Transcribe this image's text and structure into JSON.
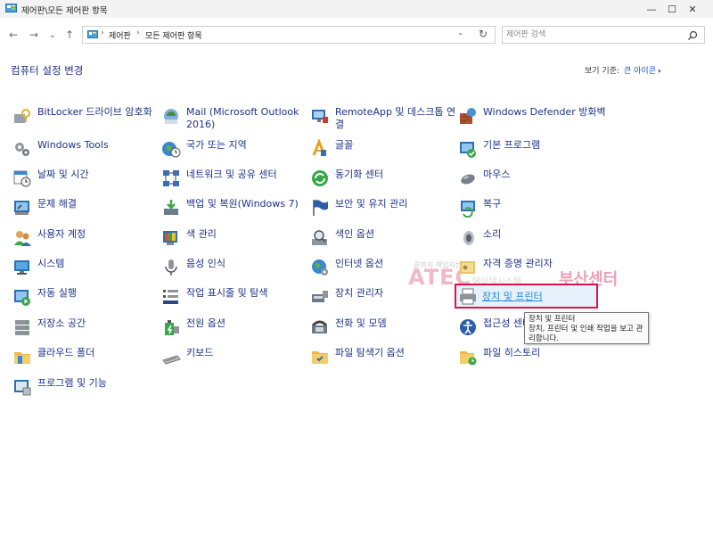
{
  "window": {
    "title": "제어판\\모든 제어판 항목",
    "minimize": "—",
    "maximize": "☐",
    "close": "✕"
  },
  "nav": {
    "back": "←",
    "forward": "→",
    "recent": "⌄",
    "up": "↑"
  },
  "address": {
    "crumbs": [
      "제어판",
      "모든 제어판 항목"
    ],
    "sep": "›",
    "dropdown": "⌄",
    "refresh": "↻"
  },
  "search": {
    "placeholder": "제어판 검색"
  },
  "heading": "컴퓨터 설정 변경",
  "view": {
    "label": "보기 기준:",
    "value": "큰 아이콘",
    "arrow": "▾"
  },
  "items": [
    {
      "label": "BitLocker 드라이브 암호화",
      "icon": "bitlocker-icon"
    },
    {
      "label": "Mail (Microsoft Outlook 2016)",
      "icon": "mail-icon"
    },
    {
      "label": "RemoteApp 및 데스크톱 연결",
      "icon": "remoteapp-icon"
    },
    {
      "label": "Windows Defender 방화벽",
      "icon": "firewall-icon"
    },
    {
      "label": "Windows Tools",
      "icon": "gears-icon"
    },
    {
      "label": "국가 또는 지역",
      "icon": "globe-clock-icon"
    },
    {
      "label": "글꼴",
      "icon": "font-icon"
    },
    {
      "label": "기본 프로그램",
      "icon": "default-programs-icon"
    },
    {
      "label": "날짜 및 시간",
      "icon": "calendar-clock-icon"
    },
    {
      "label": "네트워크 및 공유 센터",
      "icon": "network-icon"
    },
    {
      "label": "동기화 센터",
      "icon": "sync-icon"
    },
    {
      "label": "마우스",
      "icon": "mouse-icon"
    },
    {
      "label": "문제 해결",
      "icon": "troubleshoot-icon"
    },
    {
      "label": "백업 및 복원(Windows 7)",
      "icon": "backup-icon"
    },
    {
      "label": "보안 및 유지 관리",
      "icon": "flag-icon"
    },
    {
      "label": "복구",
      "icon": "recovery-icon"
    },
    {
      "label": "사용자 계정",
      "icon": "users-icon"
    },
    {
      "label": "색 관리",
      "icon": "color-management-icon"
    },
    {
      "label": "색인 옵션",
      "icon": "indexing-icon"
    },
    {
      "label": "소리",
      "icon": "speaker-icon"
    },
    {
      "label": "시스템",
      "icon": "system-icon"
    },
    {
      "label": "음성 인식",
      "icon": "microphone-icon"
    },
    {
      "label": "인터넷 옵션",
      "icon": "internet-options-icon"
    },
    {
      "label": "자격 증명 관리자",
      "icon": "credential-icon"
    },
    {
      "label": "자동 실행",
      "icon": "autoplay-icon"
    },
    {
      "label": "작업 표시줄 및 탐색",
      "icon": "taskbar-icon"
    },
    {
      "label": "장치 관리자",
      "icon": "device-manager-icon"
    },
    {
      "label": "장치 및 프린터",
      "icon": "printer-icon"
    },
    {
      "label": "저장소 공간",
      "icon": "storage-icon"
    },
    {
      "label": "전원 옵션",
      "icon": "power-icon"
    },
    {
      "label": "전화 및 모뎀",
      "icon": "phone-icon"
    },
    {
      "label": "접근성 센터",
      "icon": "accessibility-icon"
    },
    {
      "label": "클라우드 폴더",
      "icon": "cloud-folder-icon"
    },
    {
      "label": "키보드",
      "icon": "keyboard-icon"
    },
    {
      "label": "파일 탐색기 옵션",
      "icon": "folder-options-icon"
    },
    {
      "label": "파일 히스토리",
      "icon": "file-history-icon"
    },
    {
      "label": "프로그램 및 기능",
      "icon": "programs-icon"
    }
  ],
  "tooltip": {
    "title": "장치 및 프린터",
    "body": "장치, 프린터 및 인쇄 작업을 보고 관리합니다."
  },
  "watermark": {
    "small": "끝까지 책임지는",
    "brand": "ATEC",
    "mid": "에이텍시스템",
    "center": "부산센터"
  },
  "colors": {
    "link": "#1e3287",
    "highlight_border": "#e01248",
    "accent": "#1a55c8"
  }
}
